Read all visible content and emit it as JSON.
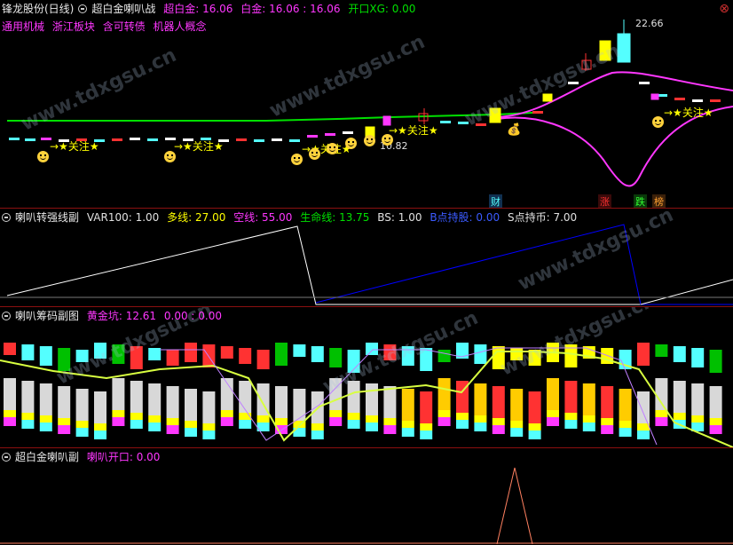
{
  "main": {
    "title": "锋龙股份(日线)",
    "indicator": "超白金喇叭战",
    "params": [
      {
        "text": "超白金: 16.06",
        "color": "#ff37ff"
      },
      {
        "text": "白金: 16.06 : 16.06",
        "color": "#ff37ff"
      },
      {
        "text": "开口XG: 0.00",
        "color": "#00e000"
      }
    ],
    "concepts": [
      "通用机械",
      "浙江板块",
      "含可转债",
      "机器人概念"
    ],
    "high_label": "22.66",
    "low_label": "10.82",
    "focus_label": "→★关注★",
    "markers": [
      "财",
      "涨",
      "跌",
      "榜"
    ]
  },
  "pane2": {
    "title": "喇叭转强线副",
    "params": [
      {
        "text": "VAR100: 1.00",
        "color": "#e0e0e0"
      },
      {
        "text": "多线: 27.00",
        "color": "#ffff00"
      },
      {
        "text": "空线: 55.00",
        "color": "#ff37ff"
      },
      {
        "text": "生命线: 13.75",
        "color": "#00e000"
      },
      {
        "text": "BS: 1.00",
        "color": "#e0e0e0"
      },
      {
        "text": "B点持股: 0.00",
        "color": "#3b5bff"
      },
      {
        "text": "S点持币: 7.00",
        "color": "#e0e0e0"
      }
    ]
  },
  "pane3": {
    "title": "喇叭筹码副图",
    "params": [
      {
        "text": "黄金坑: 12.61",
        "color": "#ff37ff"
      },
      {
        "text": "0.00 : 0.00",
        "color": "#ff37ff"
      }
    ]
  },
  "pane4": {
    "title": "超白金喇叭副",
    "params": [
      {
        "text": "喇叭开口: 0.00",
        "color": "#ff37ff"
      }
    ]
  },
  "watermark": "www.tdxgsu.cn",
  "colors": {
    "up": "#ff3232",
    "down": "#54ffff",
    "ma_green": "#00e000",
    "magenta": "#ff37ff",
    "yellow": "#ffff00",
    "blue": "#0000ff",
    "white": "#ffffff",
    "grid": "#8b1010"
  },
  "icons": {
    "close": "close-icon",
    "focus": "smile-icon",
    "money": "money-bag-icon"
  }
}
